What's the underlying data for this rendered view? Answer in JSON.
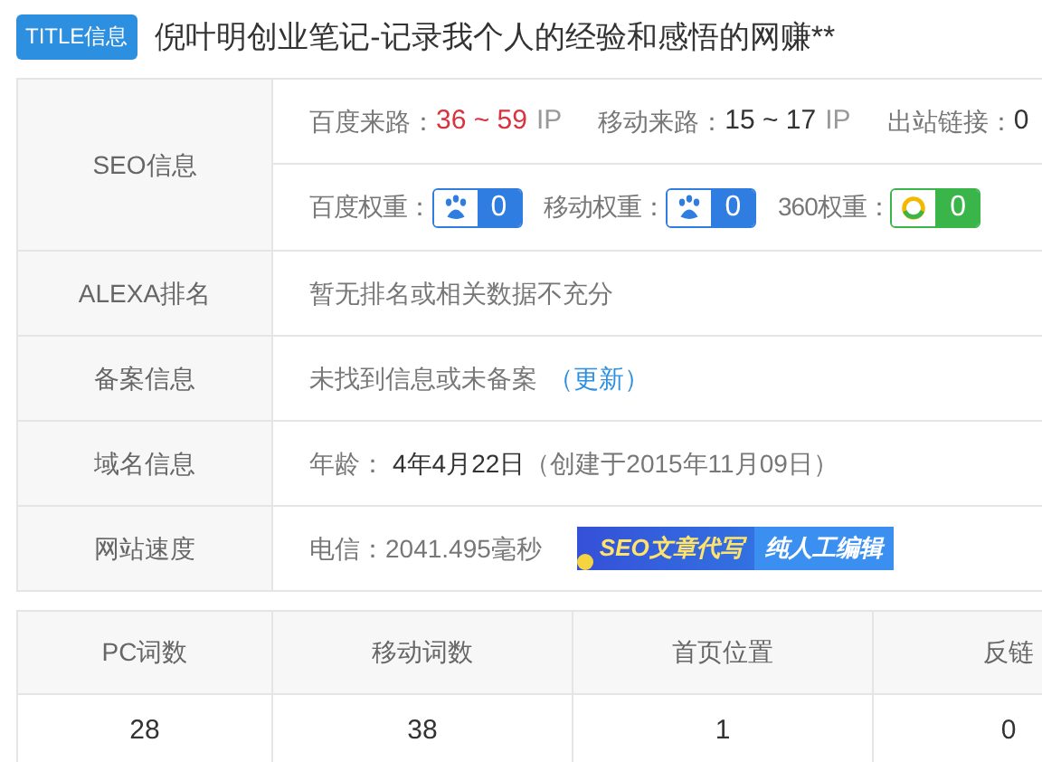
{
  "title_badge": "TITLE信息",
  "page_title": "倪叶明创业笔记-记录我个人的经验和感悟的网赚**",
  "seo": {
    "label": "SEO信息",
    "traffic": [
      {
        "label": "百度来路：",
        "value": "36 ~ 59",
        "unit": "IP",
        "highlight": true
      },
      {
        "label": "移动来路：",
        "value": "15 ~ 17",
        "unit": "IP",
        "highlight": false
      },
      {
        "label": "出站链接：",
        "value": "0",
        "highlight": false
      }
    ],
    "weights": [
      {
        "label": "百度权重：",
        "kind": "baidu",
        "value": "0"
      },
      {
        "label": "移动权重：",
        "kind": "mobile",
        "value": "0"
      },
      {
        "label": "360权重：",
        "kind": "qihoo",
        "value": "0"
      }
    ]
  },
  "info_rows": [
    {
      "label": "ALEXA排名",
      "kind": "text",
      "text": "暂无排名或相关数据不充分"
    },
    {
      "label": "备案信息",
      "kind": "link",
      "text": "未找到信息或未备案",
      "link": "（更新）"
    },
    {
      "label": "域名信息",
      "kind": "age",
      "prefix": "年龄：",
      "age": "4年4月22日",
      "note": "（创建于2015年11月09日）"
    },
    {
      "label": "网站速度",
      "kind": "speed",
      "text": "电信：2041.495毫秒",
      "banner": [
        "SEO文章代写",
        "纯人工编辑"
      ]
    }
  ],
  "stats": {
    "columns": [
      "PC词数",
      "移动词数",
      "首页位置",
      "反链"
    ],
    "rows": [
      [
        "28",
        "38",
        "1",
        "0"
      ]
    ]
  }
}
